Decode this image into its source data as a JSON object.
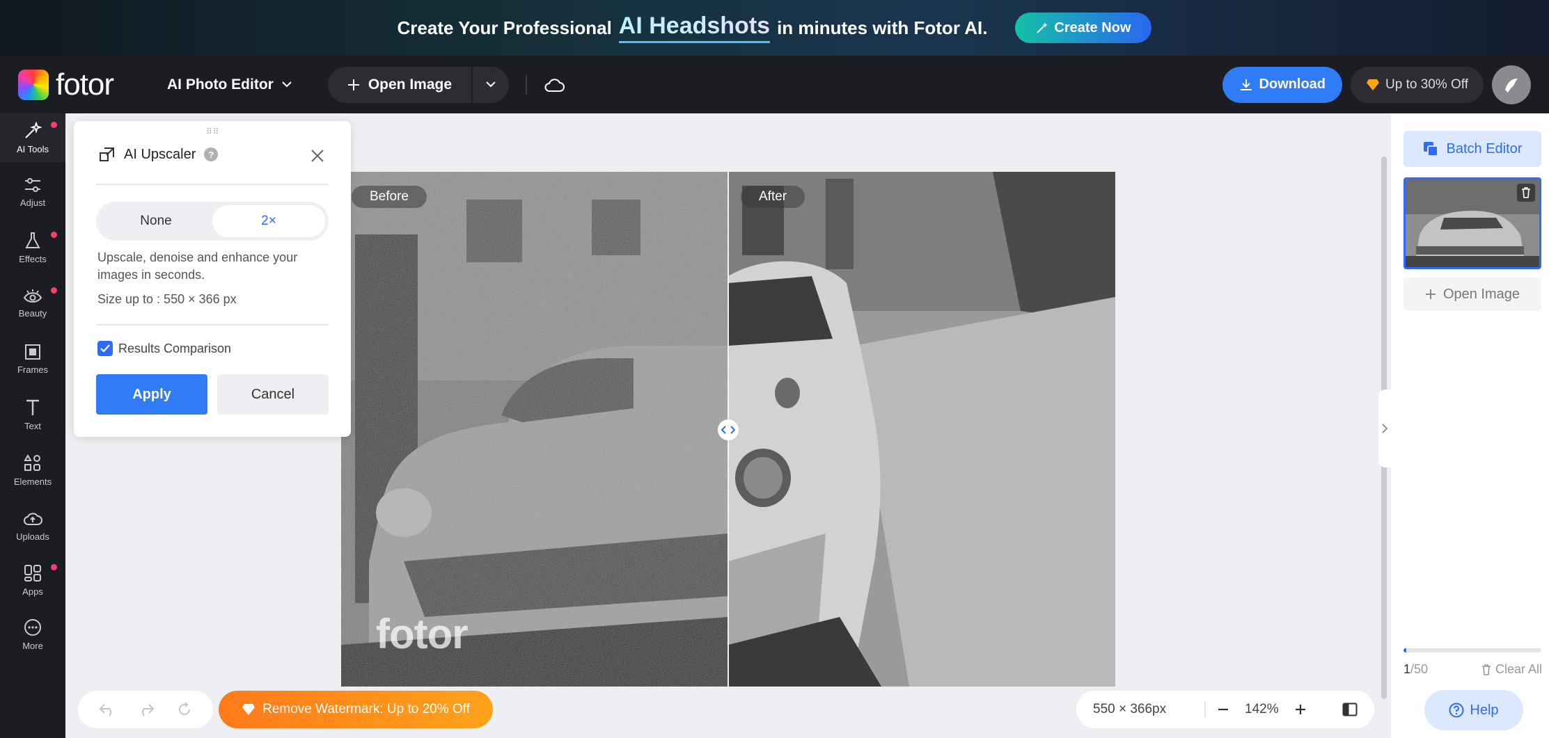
{
  "promo": {
    "text_before": "Create Your Professional",
    "highlight": "AI Headshots",
    "text_after": "in minutes with Fotor AI.",
    "cta_label": "Create Now"
  },
  "topbar": {
    "logo_text": "fotor",
    "editor_menu_label": "AI Photo Editor",
    "open_image_label": "Open Image",
    "download_label": "Download",
    "offer_label": "Up to 30% Off"
  },
  "rail": {
    "items": [
      {
        "label": "AI Tools",
        "icon": "magic-wand-icon",
        "active": true,
        "dot": true
      },
      {
        "label": "Adjust",
        "icon": "sliders-icon",
        "dot": false
      },
      {
        "label": "Effects",
        "icon": "flask-icon",
        "dot": true
      },
      {
        "label": "Beauty",
        "icon": "eye-icon",
        "dot": true
      },
      {
        "label": "Frames",
        "icon": "frame-icon",
        "dot": false
      },
      {
        "label": "Text",
        "icon": "text-icon",
        "dot": false
      },
      {
        "label": "Elements",
        "icon": "shapes-icon",
        "dot": false
      },
      {
        "label": "Uploads",
        "icon": "cloud-upload-icon",
        "dot": false
      },
      {
        "label": "Apps",
        "icon": "apps-icon",
        "dot": true
      },
      {
        "label": "More",
        "icon": "more-icon",
        "dot": false
      }
    ]
  },
  "panel": {
    "title": "AI Upscaler",
    "options": [
      "None",
      "2×"
    ],
    "selected": "2×",
    "description": "Upscale, denoise and enhance your images in seconds.",
    "size_text": "Size up to : 550 × 366 px",
    "comparison_label": "Results Comparison",
    "comparison_checked": true,
    "apply_label": "Apply",
    "cancel_label": "Cancel"
  },
  "canvas": {
    "before_label": "Before",
    "after_label": "After",
    "watermark": "fotor"
  },
  "right_panel": {
    "batch_label": "Batch Editor",
    "open_image_label": "Open Image",
    "count_current": "1",
    "count_total": "/50",
    "progress_fraction": 0.02,
    "clear_label": "Clear All",
    "help_label": "Help"
  },
  "bottom": {
    "watermark_btn": "Remove Watermark: Up to 20% Off",
    "dimensions": "550 × 366px",
    "zoom": "142%"
  },
  "colors": {
    "accent": "#2f7cf6",
    "promo_btn": "#14c0a6",
    "orange": "#ff8a1a",
    "rail_bg": "#1c1d22",
    "dot": "#ff3c6d"
  }
}
